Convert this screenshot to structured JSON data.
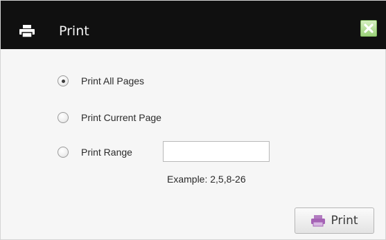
{
  "dialog": {
    "title": "Print",
    "title_icon": "printer-icon",
    "close_icon": "close-icon"
  },
  "options": {
    "all_pages": {
      "label": "Print All Pages",
      "checked": true
    },
    "current_page": {
      "label": "Print Current Page",
      "checked": false
    },
    "range": {
      "label": "Print Range",
      "checked": false
    }
  },
  "range_input": {
    "value": "",
    "placeholder": ""
  },
  "example_text": "Example: 2,5,8-26",
  "print_button": {
    "label": "Print",
    "icon": "printer-icon"
  },
  "colors": {
    "titlebar": "#101010",
    "body": "#f6f6f6",
    "button_icon": "#a563b5"
  }
}
